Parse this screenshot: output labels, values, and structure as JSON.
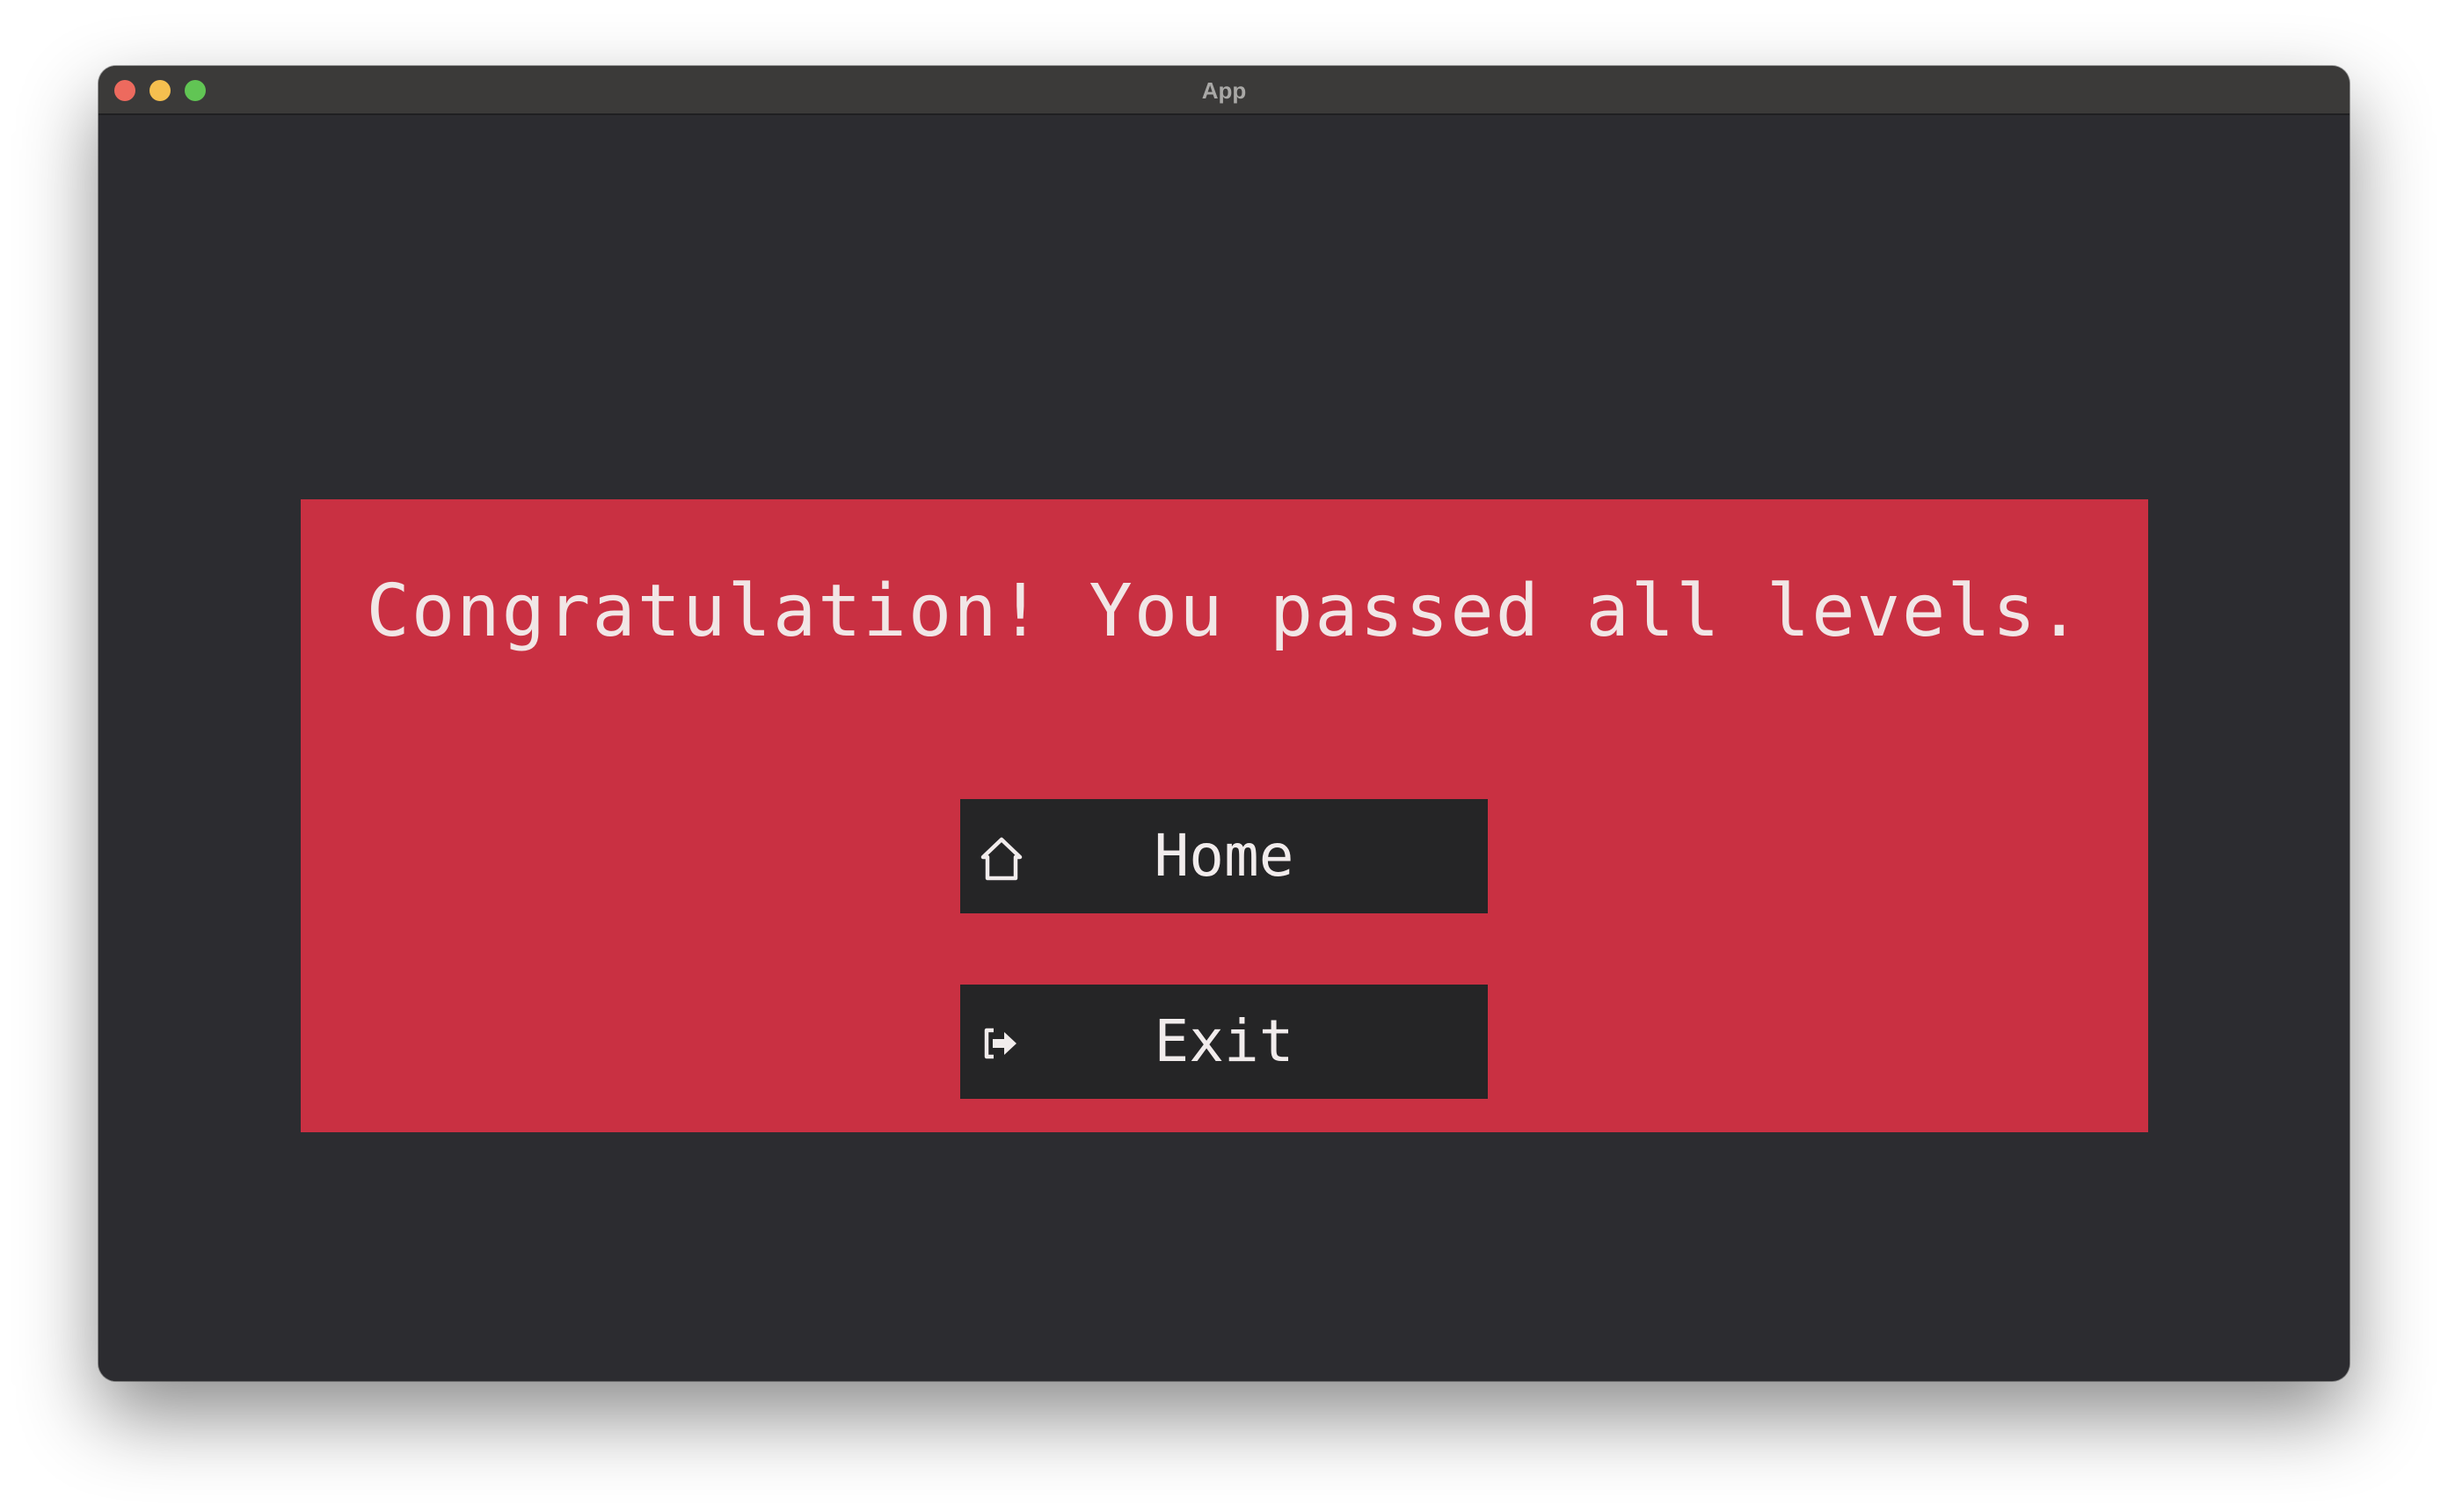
{
  "window": {
    "title": "App",
    "controls": [
      "close",
      "minimize",
      "maximize"
    ]
  },
  "dialog": {
    "message": "Congratulation! You passed all levels.",
    "buttons": {
      "home": {
        "label": "Home",
        "icon": "home-icon"
      },
      "exit": {
        "label": "Exit",
        "icon": "exit-icon"
      }
    }
  },
  "colors": {
    "background": "#2c2c30",
    "panel": "#c93042",
    "button": "#252526",
    "text": "#f1e6e6"
  }
}
